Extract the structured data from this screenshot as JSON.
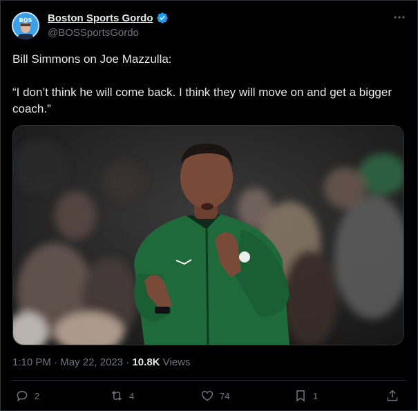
{
  "tweet": {
    "display_name": "Boston Sports Gordo",
    "handle": "@BOSSportsGordo",
    "avatar_text": "BOS",
    "text_lines": [
      "Bill Simmons on Joe Mazzulla:",
      "“I don’t think he will come back. I think they will move on and get a bigger coach.”"
    ],
    "media_alt": "Photo of Joe Mazzulla clapping in a green Celtics pullover",
    "time": "1:10 PM",
    "date": "May 22, 2023",
    "views_count": "10.8K",
    "views_label": "Views",
    "separator": "·"
  },
  "actions": {
    "replies": "2",
    "reposts": "4",
    "likes": "74",
    "bookmarks": "1"
  },
  "colors": {
    "background": "#000000",
    "text": "#e7e9ea",
    "secondary": "#71767b",
    "border": "#2f3336",
    "verified": "#1d9bf0",
    "jacket_green": "#1f6a3a"
  }
}
